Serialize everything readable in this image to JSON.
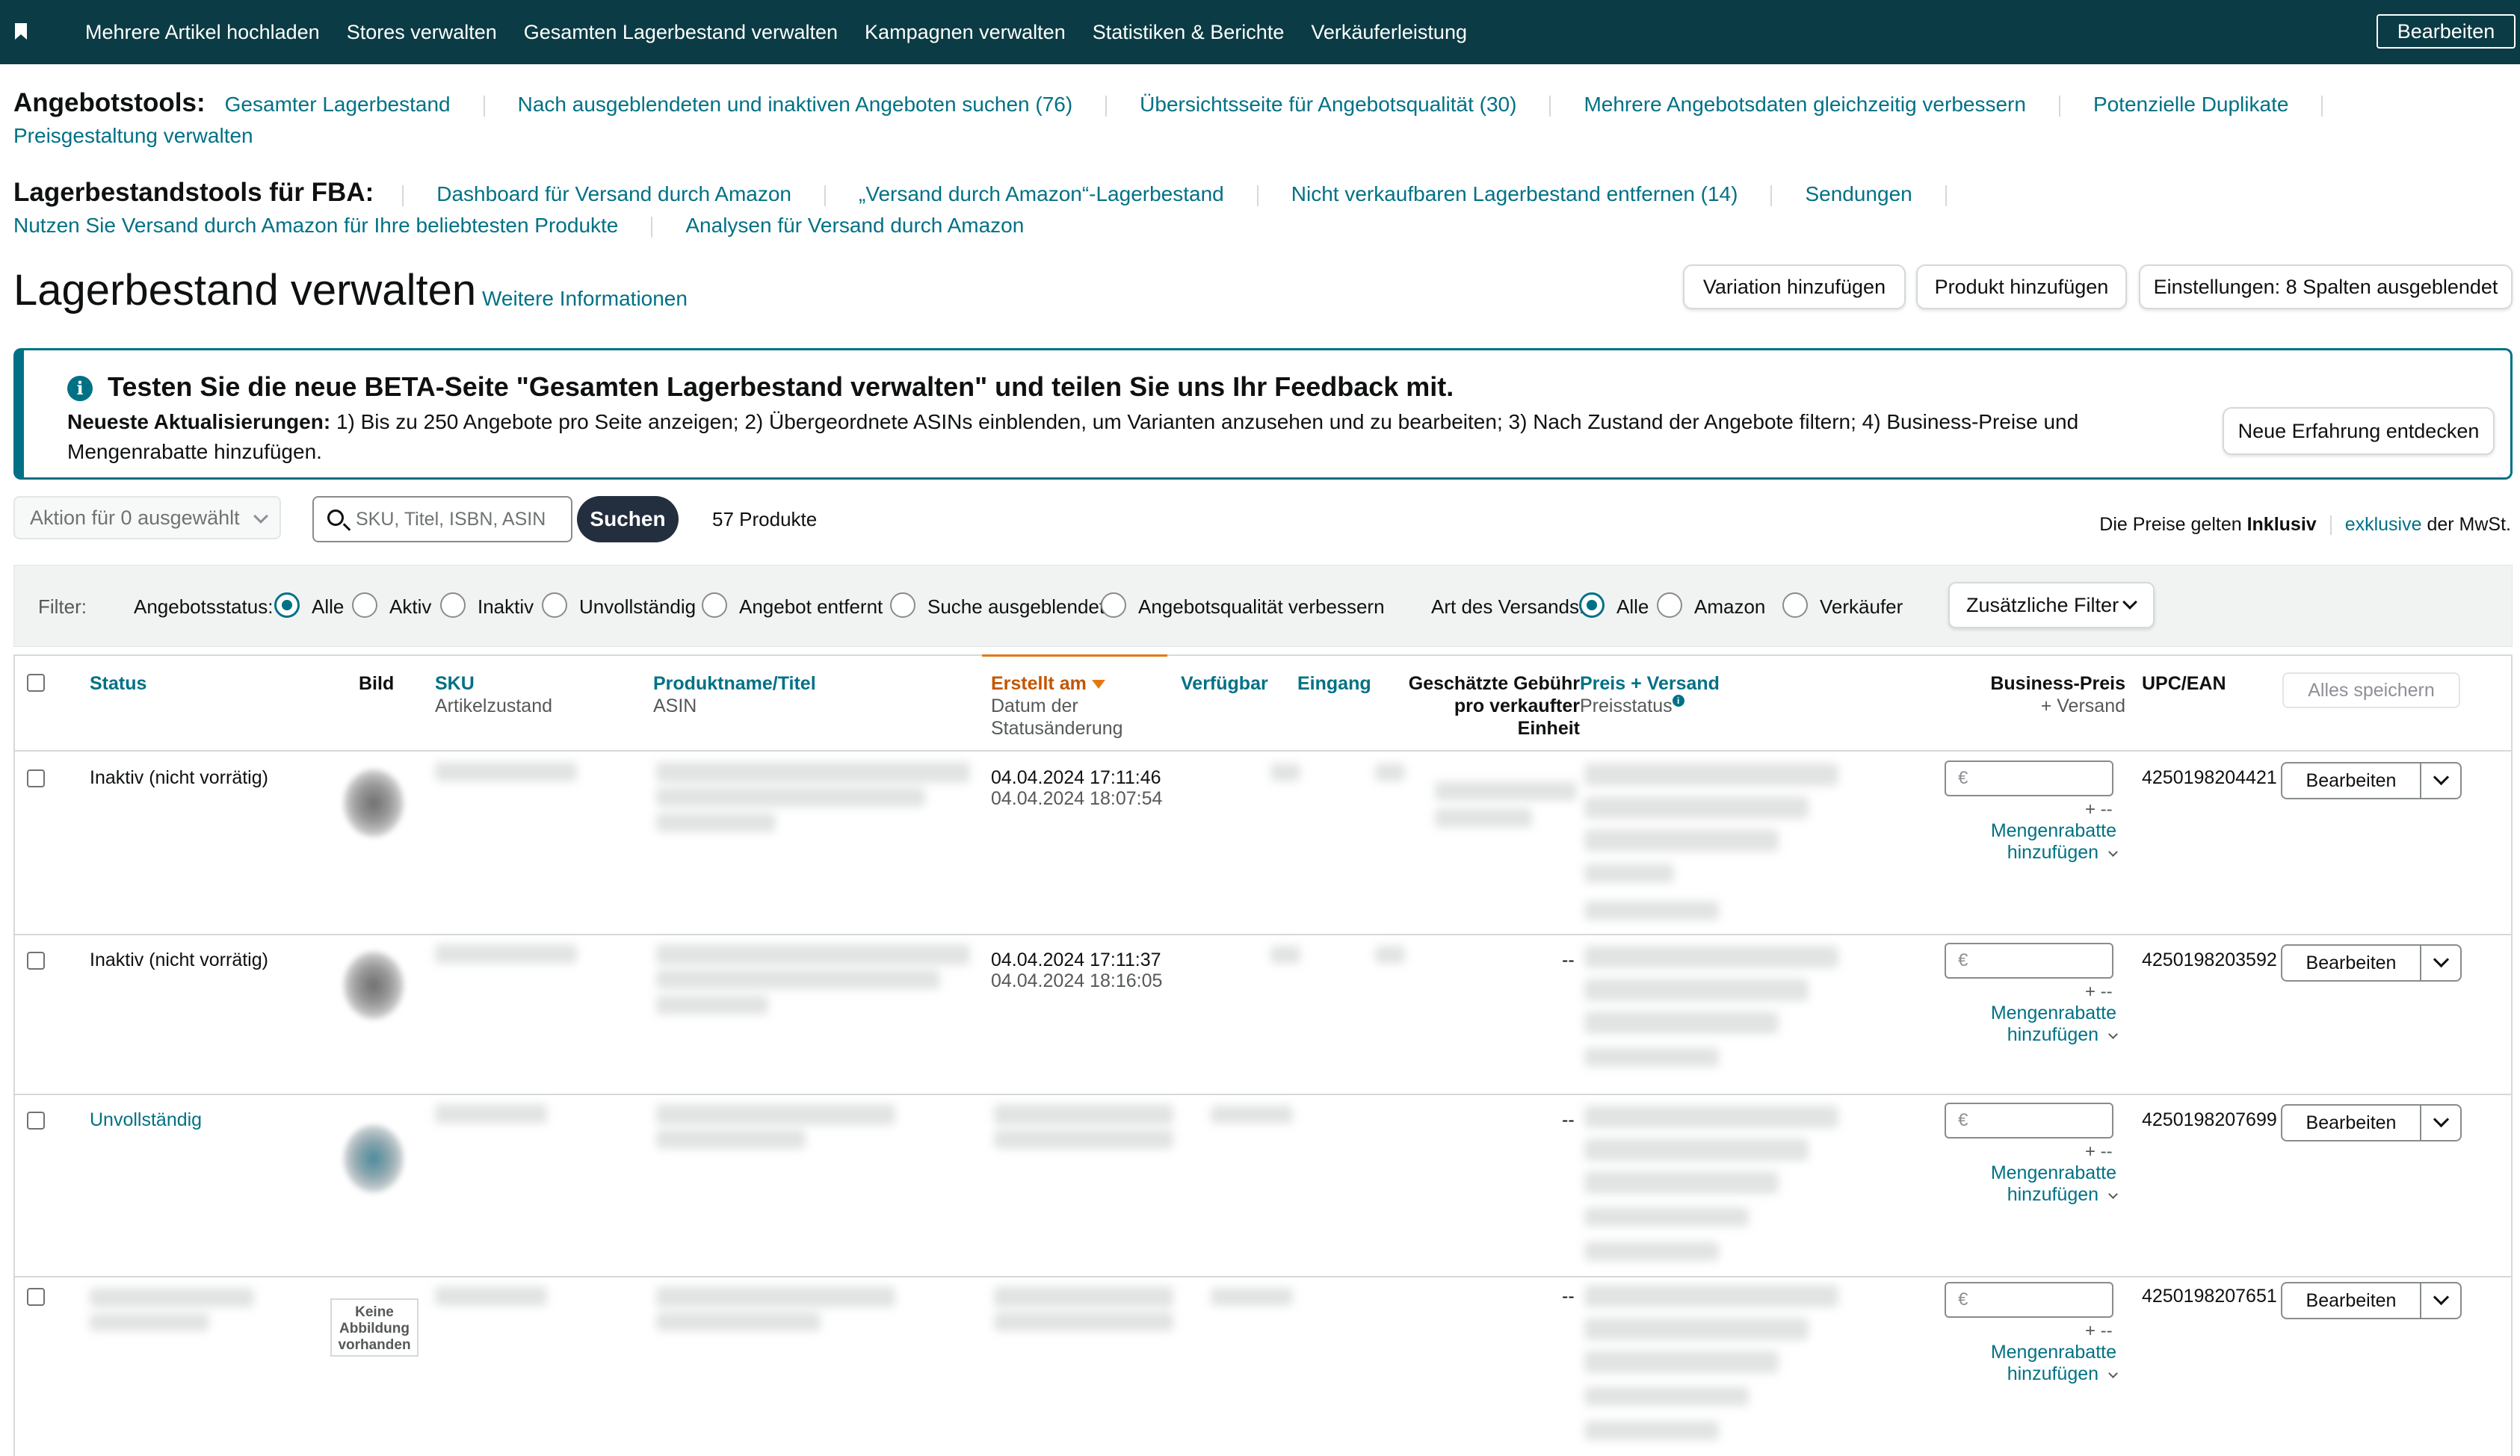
{
  "topbar": {
    "nav": [
      "Mehrere Artikel hochladen",
      "Stores verwalten",
      "Gesamten Lagerbestand verwalten",
      "Kampagnen verwalten",
      "Statistiken & Berichte",
      "Verkäuferleistung"
    ],
    "edit_label": "Bearbeiten"
  },
  "offer_tools": {
    "title": "Angebotstools:",
    "links": [
      "Gesamter Lagerbestand",
      "Nach ausgeblendeten und inaktiven Angeboten suchen (76)",
      "Übersichtsseite für Angebotsqualität (30)",
      "Mehrere Angebotsdaten gleichzeitig verbessern",
      "Potenzielle Duplikate",
      "Preisgestaltung verwalten"
    ]
  },
  "fba_tools": {
    "title": "Lagerbestandstools für FBA:",
    "links": [
      "Dashboard für Versand durch Amazon",
      "„Versand durch Amazon“-Lagerbestand",
      "Nicht verkaufbaren Lagerbestand entfernen (14)",
      "Sendungen",
      "Nutzen Sie Versand durch Amazon für Ihre beliebtesten Produkte",
      "Analysen für Versand durch Amazon"
    ]
  },
  "page": {
    "title": "Lagerbestand verwalten",
    "more_info": "Weitere Informationen",
    "buttons": {
      "add_variation": "Variation hinzufügen",
      "add_product": "Produkt hinzufügen",
      "settings": "Einstellungen: 8 Spalten ausgeblendet"
    }
  },
  "banner": {
    "title": "Testen Sie die neue BETA-Seite \"Gesamten Lagerbestand verwalten\" und teilen Sie uns Ihr Feedback mit.",
    "updates_label": "Neueste Aktualisierungen:",
    "updates_text": " 1) Bis zu 250 Angebote pro Seite anzeigen; 2) Übergeordnete ASINs einblenden, um Varianten anzusehen und zu bearbeiten; 3) Nach Zustand der Angebote filtern; 4) Business-Preise und Mengenrabatte hinzufügen.",
    "button": "Neue Erfahrung entdecken",
    "icon": "info-icon"
  },
  "search": {
    "action_label": "Aktion für 0 ausgewählt",
    "placeholder": "SKU, Titel, ISBN, ASIN",
    "button": "Suchen",
    "count": "57 Produkte",
    "price_note_1": "Die Preise gelten ",
    "price_note_inclusive": "Inklusiv",
    "price_note_link": "exklusive",
    "price_note_2": " der MwSt."
  },
  "filters": {
    "label": "Filter:",
    "status_label": "Angebotsstatus:",
    "status_options": [
      "Alle",
      "Aktiv",
      "Inaktiv",
      "Unvollständig",
      "Angebot entfernt",
      "Suche ausgeblendet",
      "Angebotsqualität verbessern"
    ],
    "status_selected": "Alle",
    "shipping_label": "Art des Versands:",
    "shipping_options": [
      "Alle",
      "Amazon",
      "Verkäufer"
    ],
    "shipping_selected": "Alle",
    "more_button": "Zusätzliche Filter"
  },
  "table": {
    "headers": {
      "status": "Status",
      "image": "Bild",
      "sku": "SKU",
      "sku_sub": "Artikelzustand",
      "product": "Produktname/Titel",
      "product_sub": "ASIN",
      "created": "Erstellt am",
      "created_sub_1": "Datum der",
      "created_sub_2": "Statusänderung",
      "available": "Verfügbar",
      "inbound": "Eingang",
      "fee_1": "Geschätzte Gebühr",
      "fee_2": "pro verkaufter",
      "fee_3": "Einheit",
      "price": "Preis + Versand",
      "price_sub": "Preisstatus",
      "business_1": "Business-Preis",
      "business_2": "+ Versand",
      "upc": "UPC/EAN"
    },
    "save_all": "Alles speichern",
    "rows": [
      {
        "status": "Inaktiv (nicht vorrätig)",
        "created": "04.04.2024 17:11:46",
        "changed": "04.04.2024 18:07:54",
        "fee": "",
        "price_placeholder": "€",
        "plus": "+ --",
        "mengen_1": "Mengenrabatte",
        "mengen_2": "hinzufügen",
        "upc": "4250198204421",
        "edit": "Bearbeiten"
      },
      {
        "status": "Inaktiv (nicht vorrätig)",
        "created": "04.04.2024 17:11:37",
        "changed": "04.04.2024 18:16:05",
        "fee": "--",
        "price_placeholder": "€",
        "plus": "+ --",
        "mengen_1": "Mengenrabatte",
        "mengen_2": "hinzufügen",
        "upc": "4250198203592",
        "edit": "Bearbeiten"
      },
      {
        "status": "Unvollständig",
        "created": "",
        "changed": "",
        "fee": "--",
        "price_placeholder": "€",
        "plus": "+ --",
        "mengen_1": "Mengenrabatte",
        "mengen_2": "hinzufügen",
        "upc": "4250198207699",
        "edit": "Bearbeiten"
      },
      {
        "status": "",
        "created": "",
        "changed": "",
        "fee": "--",
        "price_placeholder": "€",
        "plus": "+ --",
        "mengen_1": "Mengenrabatte",
        "mengen_2": "hinzufügen",
        "upc": "4250198207651",
        "edit": "Bearbeiten",
        "no_image": "Keine Abbildung vorhanden"
      }
    ]
  },
  "colors": {
    "topbar": "#0b3b44",
    "link": "#007185",
    "sort_accent": "#e47911",
    "search_button": "#232f3e"
  }
}
